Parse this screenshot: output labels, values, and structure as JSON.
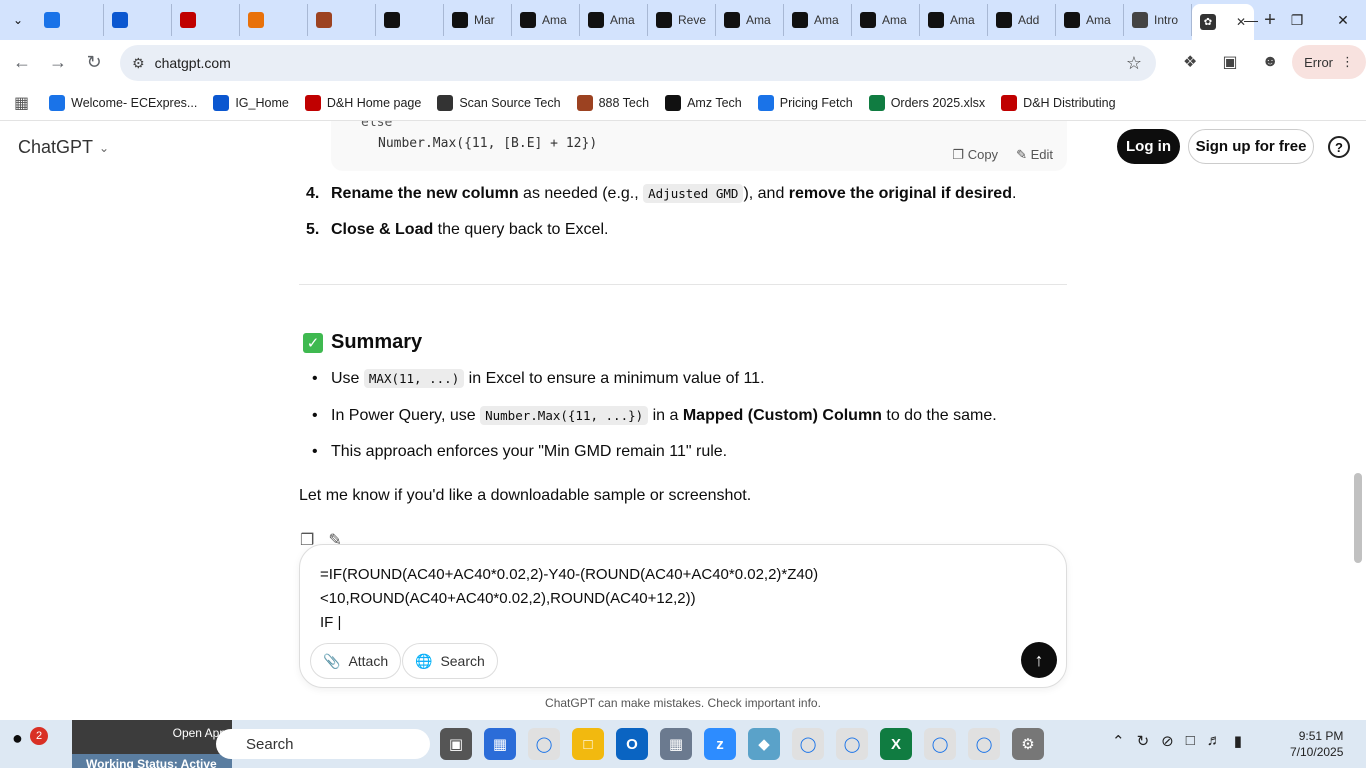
{
  "browser": {
    "tabs": [
      {
        "label": "",
        "icon": "ec-icon",
        "color": "#1a73e8"
      },
      {
        "label": "",
        "icon": "blue-g-icon",
        "color": "#0b57d0"
      },
      {
        "label": "",
        "icon": "dh-icon",
        "color": "#c00000"
      },
      {
        "label": "",
        "icon": "s-icon",
        "color": "#e8710a"
      },
      {
        "label": "",
        "icon": "link-icon",
        "color": "#9c4221"
      },
      {
        "label": "",
        "icon": "amazon-a-icon",
        "color": "#111111"
      },
      {
        "label": "Mar",
        "icon": "amazon-a-icon",
        "color": "#111111"
      },
      {
        "label": "Ama",
        "icon": "amazon-smile-icon",
        "color": "#111111"
      },
      {
        "label": "Ama",
        "icon": "amazon-smile-icon",
        "color": "#111111"
      },
      {
        "label": "Reve",
        "icon": "amazon-a-icon",
        "color": "#111111"
      },
      {
        "label": "Ama",
        "icon": "amazon-smile-icon",
        "color": "#111111"
      },
      {
        "label": "Ama",
        "icon": "amazon-smile-icon",
        "color": "#111111"
      },
      {
        "label": "Ama",
        "icon": "amazon-smile-icon",
        "color": "#111111"
      },
      {
        "label": "Ama",
        "icon": "amazon-smile-icon",
        "color": "#111111"
      },
      {
        "label": "Add",
        "icon": "amazon-a-icon",
        "color": "#111111"
      },
      {
        "label": "Ama",
        "icon": "amazon-smile-icon",
        "color": "#111111"
      },
      {
        "label": "Intro",
        "icon": "openai-icon",
        "color": "#444444"
      }
    ],
    "url": "chatgpt.com",
    "error_label": "Error",
    "bookmarks": [
      {
        "label": "Welcome- ECExpres...",
        "color": "#1a73e8"
      },
      {
        "label": "IG_Home",
        "color": "#0b57d0"
      },
      {
        "label": "D&H Home page",
        "color": "#c00000"
      },
      {
        "label": "Scan Source Tech",
        "color": "#333333"
      },
      {
        "label": "888 Tech",
        "color": "#9c4221"
      },
      {
        "label": "Amz Tech",
        "color": "#111111"
      },
      {
        "label": "Pricing Fetch",
        "color": "#1a73e8"
      },
      {
        "label": "Orders 2025.xlsx",
        "color": "#107c41"
      },
      {
        "label": "D&H Distributing",
        "color": "#c00000"
      }
    ]
  },
  "header": {
    "brand": "ChatGPT",
    "login": "Log in",
    "signup": "Sign up for free",
    "help": "?"
  },
  "code": {
    "line1": "else",
    "line2": "Number.Max({11, [B.E] + 12})",
    "copy": "Copy",
    "edit": "Edit"
  },
  "steps": [
    {
      "num": "4.",
      "b1": "Rename the new column",
      "t1": " as needed (e.g., ",
      "code": "Adjusted GMD",
      "t2": "), and ",
      "b2": "remove the original if desired",
      "t3": "."
    },
    {
      "num": "5.",
      "b1": "Close & Load",
      "t1": " the query back to Excel."
    }
  ],
  "summary": {
    "title": "Summary",
    "b1": {
      "t1": "Use ",
      "code": "MAX(11, ...)",
      "t2": " in Excel to ensure a minimum value of 11."
    },
    "b2": {
      "t1": "In Power Query, use ",
      "code": "Number.Max({11, ...})",
      "t2": " in a ",
      "bold": "Mapped (Custom) Column",
      "t3": " to do the same."
    },
    "b3": {
      "t1": "This approach enforces your \"Min GMD remain 11\" rule."
    },
    "closing": "Let me know if you'd like a downloadable sample or screenshot."
  },
  "composer": {
    "text": "=IF(ROUND(AC40+AC40*0.02,2)-Y40-(ROUND(AC40+AC40*0.02,2)*Z40)\n<10,ROUND(AC40+AC40*0.02,2),ROUND(AC40+12,2))\nIF |",
    "attach": "Attach",
    "search": "Search"
  },
  "disclaimer": "ChatGPT can make mistakes. Check important info.",
  "taskbar": {
    "notif_count": "2",
    "open_app": "Open App",
    "working_status": "Working Status: Active",
    "search": "Search",
    "time": "9:51 PM",
    "date": "7/10/2025"
  }
}
